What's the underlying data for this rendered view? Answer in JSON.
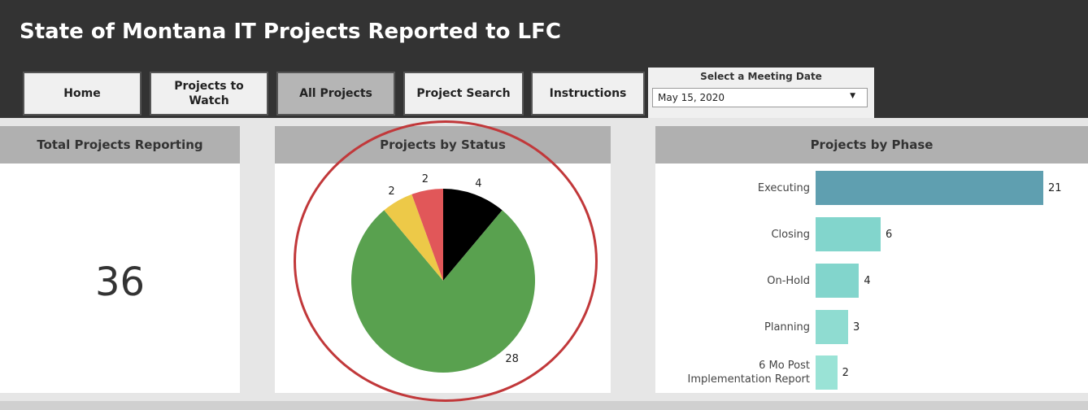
{
  "header": {
    "title": "State of Montana IT Projects Reported to LFC",
    "nav": [
      {
        "label": "Home"
      },
      {
        "label": "Projects to\nWatch"
      },
      {
        "label": "All Projects"
      },
      {
        "label": "Project Search"
      },
      {
        "label": "Instructions"
      }
    ],
    "date_filter": {
      "label": "Select a Meeting Date",
      "value": "May 15, 2020"
    }
  },
  "total_panel": {
    "title": "Total Projects Reporting",
    "value": "36"
  },
  "status_panel": {
    "title": "Projects by Status"
  },
  "phase_panel": {
    "title": "Projects  by Phase"
  },
  "chart_data": [
    {
      "type": "pie",
      "title": "Projects by Status",
      "slices": [
        {
          "value": 4,
          "color": "#000000"
        },
        {
          "value": 28,
          "color": "#59a14f"
        },
        {
          "value": 2,
          "color": "#edc948"
        },
        {
          "value": 2,
          "color": "#e15759"
        }
      ]
    },
    {
      "type": "bar",
      "orientation": "horizontal",
      "title": "Projects  by Phase",
      "categories": [
        "Executing",
        "Closing",
        "On-Hold",
        "Planning",
        "6 Mo Post\nImplementation Report"
      ],
      "values": [
        21,
        6,
        4,
        3,
        2
      ],
      "colors": [
        "#5f9fb0",
        "#82d5cc",
        "#82d5cc",
        "#8fdcd1",
        "#9ae3d6"
      ]
    }
  ]
}
